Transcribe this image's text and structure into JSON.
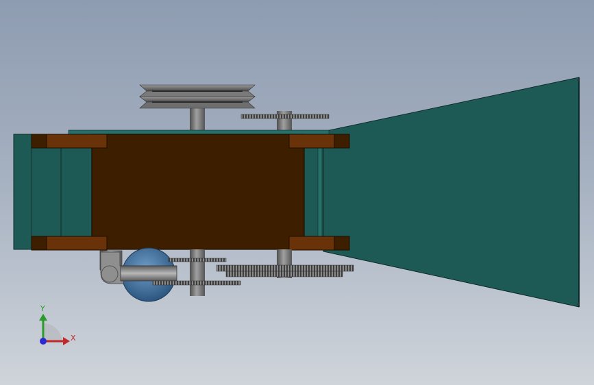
{
  "viewport": {
    "name": "3d-model-viewport",
    "background": {
      "top": "#8e9cb1",
      "bottom": "#cfd4da"
    }
  },
  "model": {
    "colors": {
      "body": "#3d1f00",
      "bracket": "#6a3208",
      "teal": "#1e5a55",
      "teal_light": "#27706a",
      "shaft": "#7a7a7a",
      "gear": "#5a5a5a",
      "motor": "#3f6f9a",
      "pipe": "#8a8a8a"
    }
  },
  "triad": {
    "x_label": "X",
    "y_label": "Y",
    "x_color": "#c0282a",
    "y_color": "#2a9a2a",
    "z_color": "#2a2ad0"
  }
}
